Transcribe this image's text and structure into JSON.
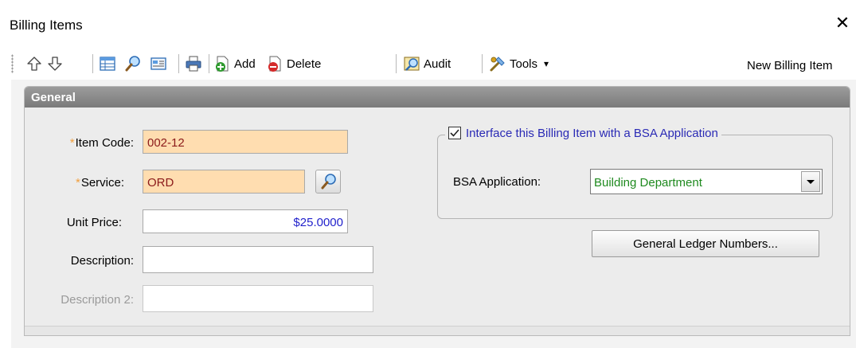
{
  "window": {
    "title": "Billing Items",
    "close_glyph": "✕"
  },
  "toolbar": {
    "items": [
      {
        "icon": "arrow-up-icon"
      },
      {
        "icon": "arrow-down-icon"
      },
      {
        "icon": "grid-view-icon"
      },
      {
        "icon": "search-icon"
      },
      {
        "icon": "form-view-icon"
      },
      {
        "icon": "print-icon"
      },
      {
        "icon": "add-icon",
        "label": "Add"
      },
      {
        "icon": "delete-icon",
        "label": "Delete"
      },
      {
        "icon": "audit-icon",
        "label": "Audit"
      },
      {
        "icon": "tools-icon",
        "label": "Tools",
        "dropdown_glyph": "▾"
      }
    ],
    "status_label": "New Billing Item"
  },
  "panel": {
    "title": "General",
    "fields": {
      "item_code": {
        "label": "Item Code:",
        "value": "002-12",
        "required": true
      },
      "service": {
        "label": "Service:",
        "value": "ORD",
        "required": true
      },
      "unit_price": {
        "label": "Unit Price:",
        "value": "$25.0000"
      },
      "description": {
        "label": "Description:",
        "value": ""
      },
      "description2": {
        "label": "Description 2:",
        "value": ""
      }
    },
    "required_marker": "*",
    "interface": {
      "checkbox_label": "Interface this Billing Item with a BSA Application",
      "checked": true,
      "app_label": "BSA Application:",
      "app_value": "Building Department"
    },
    "gl_button_label": "General Ledger Numbers..."
  },
  "colors": {
    "required_bg": "#ffddb0",
    "link_blue": "#2a2ab5",
    "select_green": "#1f8a1f",
    "header_gray": "#8a8a8a"
  }
}
